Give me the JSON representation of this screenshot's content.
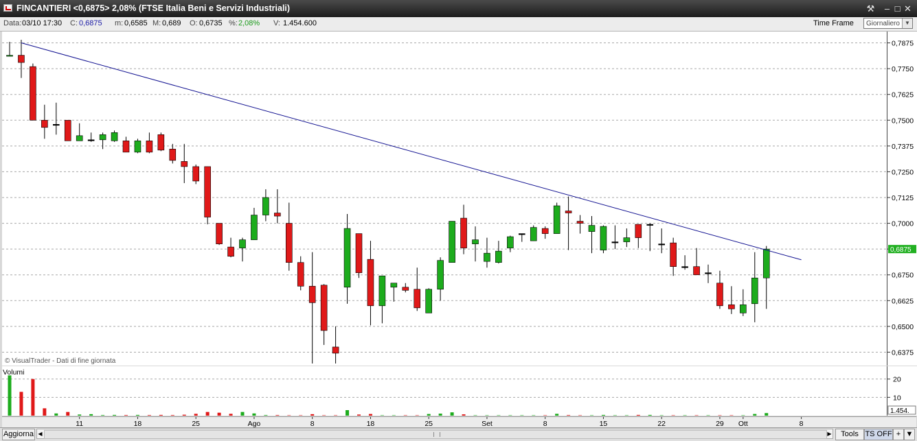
{
  "window": {
    "title": "FINCANTIERI <0,6875> 2,08%  (FTSE Italia Beni e Servizi Industriali)",
    "tools_icon": "tools-icon",
    "buttons": [
      "minimize-icon",
      "maximize-icon",
      "close-icon"
    ]
  },
  "info_bar": {
    "date_label": "Data:",
    "date_value": "03/10 17:30",
    "close_label": "C:",
    "close_value": "0,6875",
    "min_label": "m:",
    "min_value": "0,6585",
    "max_label": "M:",
    "max_value": "0,689",
    "open_label": "O:",
    "open_value": "0,6735",
    "pct_label": "%:",
    "pct_value": "2,08%",
    "volume_label": "V:",
    "volume_value": "1.454.600",
    "timeframe_label": "Time Frame",
    "timeframe_selected": "Giornaliero"
  },
  "colors": {
    "up": "#1dac1d",
    "down": "#e01919",
    "trendline": "#101090",
    "close_text": "#1a1aa6",
    "pct_text": "#1b9a1b",
    "current_price_box": "#22b022"
  },
  "chart": {
    "watermark": "© VisualTrader - Dati di fine giornata",
    "volume_label": "Volumi",
    "current_price_label": "0,6875",
    "volume_readout": "1.454."
  },
  "chart_data": [
    {
      "type": "candlestick",
      "y_ticks": [
        "0,7875",
        "0,7750",
        "0,7625",
        "0,7500",
        "0,7375",
        "0,7250",
        "0,7125",
        "0,7000",
        "0,6875",
        "0,6750",
        "0,6625",
        "0,6500",
        "0,6375"
      ],
      "ylim": [
        0.631,
        0.793
      ],
      "grid": true,
      "x_ticks": [
        {
          "label": "11",
          "index": 6
        },
        {
          "label": "18",
          "index": 11
        },
        {
          "label": "25",
          "index": 16
        },
        {
          "label": "Ago",
          "index": 21
        },
        {
          "label": "8",
          "index": 26
        },
        {
          "label": "18",
          "index": 31
        },
        {
          "label": "25",
          "index": 36
        },
        {
          "label": "Set",
          "index": 41
        },
        {
          "label": "8",
          "index": 46
        },
        {
          "label": "15",
          "index": 51
        },
        {
          "label": "22",
          "index": 56
        },
        {
          "label": "29",
          "index": 61
        },
        {
          "label": "Ott",
          "index": 63
        },
        {
          "label": "8",
          "index": 68
        }
      ],
      "candles": [
        {
          "o": 0.781,
          "h": 0.788,
          "l": 0.781,
          "c": 0.7815
        },
        {
          "o": 0.7815,
          "h": 0.789,
          "l": 0.7705,
          "c": 0.778
        },
        {
          "o": 0.776,
          "h": 0.7775,
          "l": 0.75,
          "c": 0.75
        },
        {
          "o": 0.75,
          "h": 0.7575,
          "l": 0.741,
          "c": 0.7465
        },
        {
          "o": 0.748,
          "h": 0.7585,
          "l": 0.743,
          "c": 0.748
        },
        {
          "o": 0.75,
          "h": 0.75,
          "l": 0.74,
          "c": 0.74
        },
        {
          "o": 0.74,
          "h": 0.7485,
          "l": 0.74,
          "c": 0.7425
        },
        {
          "o": 0.7405,
          "h": 0.744,
          "l": 0.7395,
          "c": 0.7405
        },
        {
          "o": 0.7405,
          "h": 0.744,
          "l": 0.736,
          "c": 0.743
        },
        {
          "o": 0.74,
          "h": 0.745,
          "l": 0.7395,
          "c": 0.744
        },
        {
          "o": 0.74,
          "h": 0.742,
          "l": 0.7345,
          "c": 0.7345
        },
        {
          "o": 0.7345,
          "h": 0.741,
          "l": 0.734,
          "c": 0.74
        },
        {
          "o": 0.74,
          "h": 0.744,
          "l": 0.734,
          "c": 0.7345
        },
        {
          "o": 0.743,
          "h": 0.744,
          "l": 0.735,
          "c": 0.7355
        },
        {
          "o": 0.736,
          "h": 0.7385,
          "l": 0.729,
          "c": 0.7305
        },
        {
          "o": 0.73,
          "h": 0.7385,
          "l": 0.7195,
          "c": 0.7275
        },
        {
          "o": 0.7275,
          "h": 0.7285,
          "l": 0.719,
          "c": 0.7205
        },
        {
          "o": 0.7275,
          "h": 0.7275,
          "l": 0.6995,
          "c": 0.703
        },
        {
          "o": 0.7,
          "h": 0.7,
          "l": 0.6895,
          "c": 0.69
        },
        {
          "o": 0.6885,
          "h": 0.693,
          "l": 0.6835,
          "c": 0.684
        },
        {
          "o": 0.688,
          "h": 0.693,
          "l": 0.6815,
          "c": 0.692
        },
        {
          "o": 0.692,
          "h": 0.7075,
          "l": 0.692,
          "c": 0.704
        },
        {
          "o": 0.704,
          "h": 0.7165,
          "l": 0.701,
          "c": 0.7125
        },
        {
          "o": 0.705,
          "h": 0.7165,
          "l": 0.7,
          "c": 0.7035
        },
        {
          "o": 0.7,
          "h": 0.71,
          "l": 0.677,
          "c": 0.681
        },
        {
          "o": 0.681,
          "h": 0.684,
          "l": 0.6675,
          "c": 0.6695
        },
        {
          "o": 0.6695,
          "h": 0.686,
          "l": 0.632,
          "c": 0.6615
        },
        {
          "o": 0.67,
          "h": 0.6705,
          "l": 0.641,
          "c": 0.648
        },
        {
          "o": 0.64,
          "h": 0.65,
          "l": 0.632,
          "c": 0.637
        },
        {
          "o": 0.669,
          "h": 0.7045,
          "l": 0.661,
          "c": 0.6975
        },
        {
          "o": 0.695,
          "h": 0.695,
          "l": 0.6735,
          "c": 0.676
        },
        {
          "o": 0.6825,
          "h": 0.6915,
          "l": 0.6505,
          "c": 0.66
        },
        {
          "o": 0.66,
          "h": 0.6745,
          "l": 0.6515,
          "c": 0.6745
        },
        {
          "o": 0.669,
          "h": 0.671,
          "l": 0.662,
          "c": 0.671
        },
        {
          "o": 0.669,
          "h": 0.671,
          "l": 0.6665,
          "c": 0.6675
        },
        {
          "o": 0.668,
          "h": 0.6785,
          "l": 0.6575,
          "c": 0.659
        },
        {
          "o": 0.6565,
          "h": 0.6685,
          "l": 0.6565,
          "c": 0.668
        },
        {
          "o": 0.668,
          "h": 0.6835,
          "l": 0.6625,
          "c": 0.682
        },
        {
          "o": 0.681,
          "h": 0.701,
          "l": 0.681,
          "c": 0.701
        },
        {
          "o": 0.7025,
          "h": 0.709,
          "l": 0.685,
          "c": 0.688
        },
        {
          "o": 0.69,
          "h": 0.6985,
          "l": 0.6815,
          "c": 0.692
        },
        {
          "o": 0.6815,
          "h": 0.693,
          "l": 0.6785,
          "c": 0.6855
        },
        {
          "o": 0.681,
          "h": 0.6915,
          "l": 0.6805,
          "c": 0.6865
        },
        {
          "o": 0.688,
          "h": 0.694,
          "l": 0.686,
          "c": 0.6935
        },
        {
          "o": 0.695,
          "h": 0.695,
          "l": 0.691,
          "c": 0.695
        },
        {
          "o": 0.6915,
          "h": 0.699,
          "l": 0.6915,
          "c": 0.698
        },
        {
          "o": 0.6975,
          "h": 0.6985,
          "l": 0.6925,
          "c": 0.695
        },
        {
          "o": 0.695,
          "h": 0.71,
          "l": 0.695,
          "c": 0.7085
        },
        {
          "o": 0.706,
          "h": 0.713,
          "l": 0.687,
          "c": 0.705
        },
        {
          "o": 0.701,
          "h": 0.704,
          "l": 0.695,
          "c": 0.7
        },
        {
          "o": 0.696,
          "h": 0.7035,
          "l": 0.6855,
          "c": 0.699
        },
        {
          "o": 0.687,
          "h": 0.699,
          "l": 0.6855,
          "c": 0.6985
        },
        {
          "o": 0.691,
          "h": 0.699,
          "l": 0.6875,
          "c": 0.691
        },
        {
          "o": 0.691,
          "h": 0.6975,
          "l": 0.6885,
          "c": 0.693
        },
        {
          "o": 0.6995,
          "h": 0.6995,
          "l": 0.688,
          "c": 0.693
        },
        {
          "o": 0.6995,
          "h": 0.7,
          "l": 0.6865,
          "c": 0.6995
        },
        {
          "o": 0.69,
          "h": 0.6975,
          "l": 0.6855,
          "c": 0.69
        },
        {
          "o": 0.6905,
          "h": 0.693,
          "l": 0.6745,
          "c": 0.679
        },
        {
          "o": 0.679,
          "h": 0.6845,
          "l": 0.6775,
          "c": 0.679
        },
        {
          "o": 0.679,
          "h": 0.688,
          "l": 0.675,
          "c": 0.675
        },
        {
          "o": 0.676,
          "h": 0.68,
          "l": 0.671,
          "c": 0.676
        },
        {
          "o": 0.671,
          "h": 0.677,
          "l": 0.6585,
          "c": 0.66
        },
        {
          "o": 0.6605,
          "h": 0.6695,
          "l": 0.656,
          "c": 0.6585
        },
        {
          "o": 0.6565,
          "h": 0.668,
          "l": 0.655,
          "c": 0.6605
        },
        {
          "o": 0.661,
          "h": 0.686,
          "l": 0.652,
          "c": 0.6735
        },
        {
          "o": 0.6735,
          "h": 0.689,
          "l": 0.6585,
          "c": 0.6875
        }
      ],
      "trendline": {
        "start": {
          "index": 1,
          "value": 0.7875
        },
        "end": {
          "index": 68,
          "value": 0.6823
        }
      }
    },
    {
      "type": "bar",
      "y_ticks": [
        "20",
        "10"
      ],
      "ylim": [
        0,
        27
      ],
      "values": [
        22,
        13,
        20,
        4,
        1.2,
        2,
        0.6,
        0.8,
        0.3,
        0.4,
        0.3,
        0.4,
        0.3,
        0.4,
        0.3,
        0.5,
        1,
        2,
        1.6,
        1,
        2,
        1.2,
        0.3,
        0.3,
        0.2,
        0.2,
        0.8,
        0.2,
        0.2,
        3,
        0.6,
        0.9,
        0.2,
        0.2,
        0.2,
        0.2,
        0.9,
        1.1,
        1.8,
        0.7,
        0.2,
        0.2,
        0.2,
        0.2,
        0.2,
        0.2,
        0.2,
        1,
        0.3,
        0.2,
        0.2,
        0.4,
        0.2,
        0.2,
        0.4,
        0.4,
        0.2,
        0.2,
        0.2,
        0.2,
        0.2,
        0.2,
        0.2,
        0.2,
        0.9,
        1.4
      ]
    }
  ]
}
